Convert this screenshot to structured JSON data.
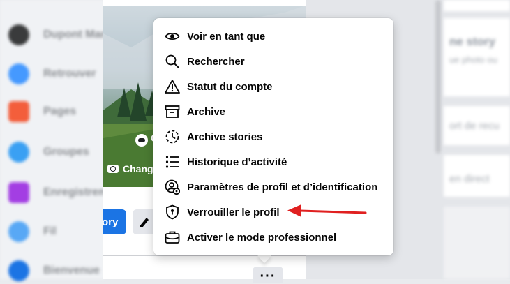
{
  "sidebar": {
    "items": [
      {
        "label": "Dupont Marie",
        "color": "#3a3b3c"
      },
      {
        "label": "Retrouver",
        "color": "#4599ff"
      },
      {
        "label": "Pages",
        "color": "#f35e3b"
      },
      {
        "label": "Groupes",
        "color": "#3aa0f3"
      },
      {
        "label": "Enregistrements",
        "color": "#a33ee3"
      },
      {
        "label": "Fil",
        "color": "#58a8f5"
      },
      {
        "label": "Bienvenue",
        "color": "#1b74e4"
      }
    ]
  },
  "profile": {
    "cover_text": "C",
    "change_cover_label": "Chang",
    "story_label": "ory"
  },
  "right_panel": {
    "title": "ne story",
    "subtitle": "ue photo ou",
    "item1": "ort de recu",
    "item2": "en direct"
  },
  "menu": {
    "items": [
      {
        "label": "Voir en tant que",
        "icon": "eye-icon"
      },
      {
        "label": "Rechercher",
        "icon": "search-icon"
      },
      {
        "label": "Statut du compte",
        "icon": "warning-icon"
      },
      {
        "label": "Archive",
        "icon": "archive-box-icon"
      },
      {
        "label": "Archive stories",
        "icon": "story-archive-icon"
      },
      {
        "label": "Historique d’activité",
        "icon": "list-icon"
      },
      {
        "label": "Paramètres de profil et d’identification",
        "icon": "profile-settings-icon"
      },
      {
        "label": "Verrouiller le profil",
        "icon": "shield-lock-icon"
      },
      {
        "label": "Activer le mode professionnel",
        "icon": "briefcase-icon"
      }
    ]
  },
  "colors": {
    "accent": "#1b74e4",
    "annotation_arrow": "#e02020",
    "menu_text": "#050505"
  }
}
